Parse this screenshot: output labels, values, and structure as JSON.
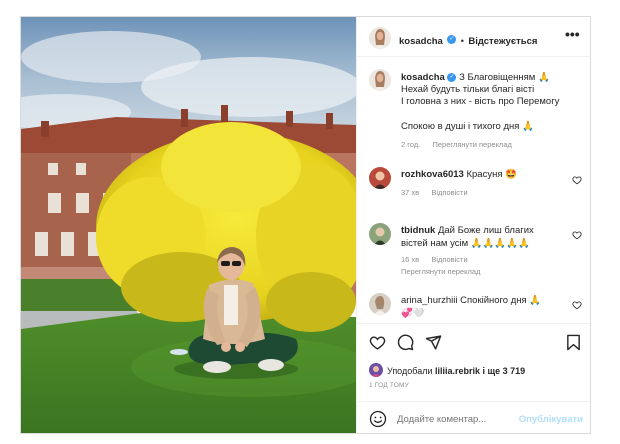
{
  "author": {
    "username": "kosadcha",
    "follow_label": "Відстежується",
    "separator": "•"
  },
  "caption": {
    "username": "kosadcha",
    "lines": [
      "З Благовіщенням 🙏",
      "Нехай будуть тільки благі вісті",
      "І головна з них - вість про Перемогу",
      "Спокою в душі і тихого дня 🙏"
    ],
    "time": "2 год.",
    "translate": "Переглянути переклад"
  },
  "comments": [
    {
      "username": "rozhkova6013",
      "text": "Красуня 🤩",
      "time": "37 хв",
      "reply": "Відповісти"
    },
    {
      "username": "tbidnuk",
      "text_line1": "Дай Боже лиш благих",
      "text_line2": "вістей нам усім 🙏🙏🙏🙏🙏",
      "time": "16 хв",
      "reply": "Відповісти",
      "translate": "Переглянути переклад"
    },
    {
      "username": "arina_hurzhiii",
      "text_line1": "Спокійного дня 🙏",
      "text_line2": "💞🤍"
    }
  ],
  "likes": {
    "prefix": "Уподобали",
    "user": "liliia.rebrik",
    "suffix": "і ще 3 719"
  },
  "timestamp": "1 ГОД ТОМУ",
  "add_comment": {
    "placeholder": "Додайте коментар...",
    "publish": "Опублікувати"
  },
  "colors": {
    "blue": "#3897f0",
    "publish_disabled": "#b2dffc",
    "text": "#262626",
    "muted": "#8e8e8e"
  }
}
